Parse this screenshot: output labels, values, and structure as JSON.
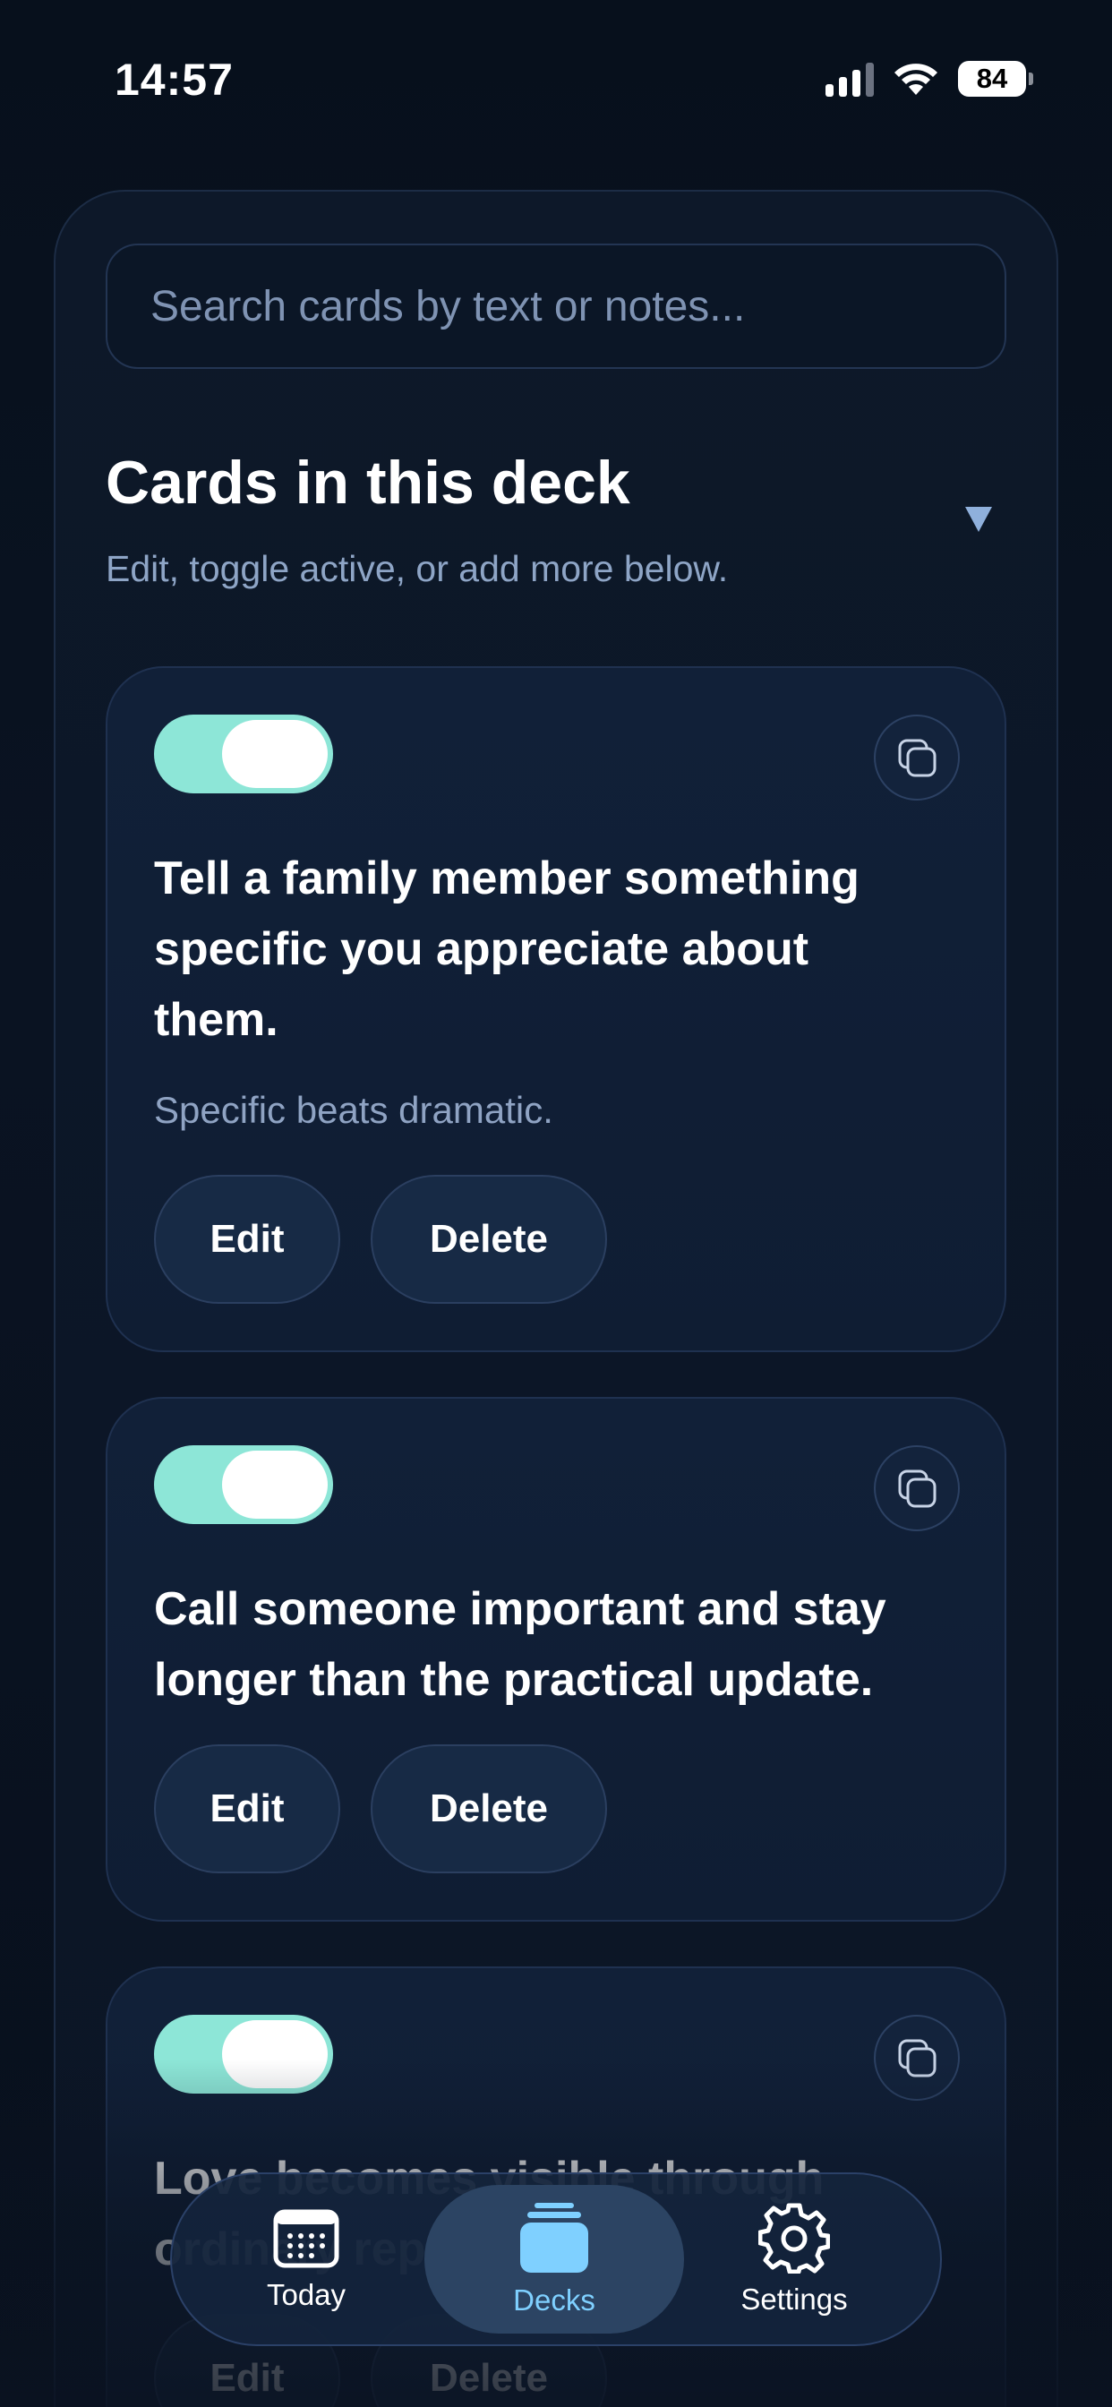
{
  "status_bar": {
    "time": "14:57",
    "battery": "84"
  },
  "search": {
    "placeholder": "Search cards by text or notes..."
  },
  "section": {
    "title": "Cards in this deck",
    "subtitle": "Edit, toggle active, or add more below."
  },
  "cards": [
    {
      "active": true,
      "text": "Tell a family member something specific you appreciate about them.",
      "note": "Specific beats dramatic.",
      "edit_label": "Edit",
      "delete_label": "Delete"
    },
    {
      "active": true,
      "text": "Call someone important and stay longer than the practical update.",
      "note": "",
      "edit_label": "Edit",
      "delete_label": "Delete"
    },
    {
      "active": true,
      "text": "Love becomes visible through ordinary repetition.",
      "note": "",
      "edit_label": "Edit",
      "delete_label": "Delete"
    }
  ],
  "tabs": [
    {
      "label": "Today",
      "icon": "calendar-icon",
      "selected": false
    },
    {
      "label": "Decks",
      "icon": "decks-icon",
      "selected": true
    },
    {
      "label": "Settings",
      "icon": "gear-icon",
      "selected": false
    }
  ],
  "colors": {
    "background": "#0a1020",
    "toggle_on": "#8de6d7",
    "accent": "#7fd0ff"
  }
}
